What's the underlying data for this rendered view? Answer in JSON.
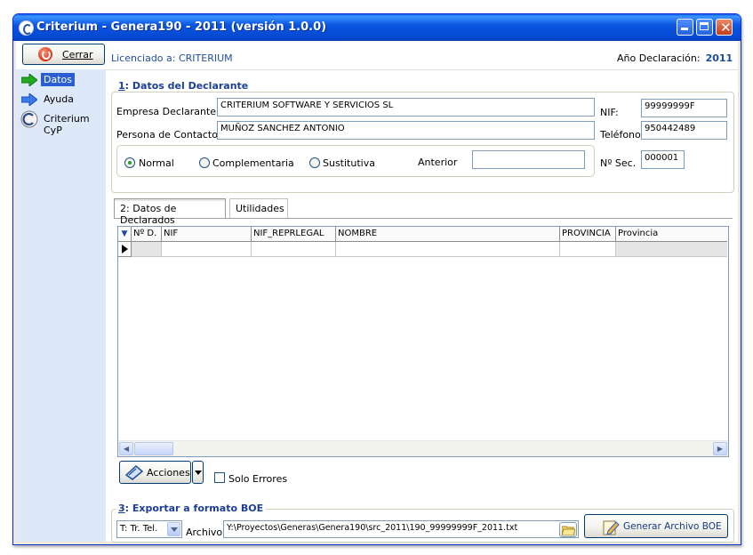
{
  "window": {
    "title": "Criterium - Genera190 - 2011 (versión 1.0.0)"
  },
  "toolbar": {
    "close_label": "Cerrar",
    "licensee": "Licenciado a: CRITERIUM",
    "year_label": "Año Declaración:",
    "year_value": "2011"
  },
  "sidebar": {
    "items": [
      {
        "label": "Datos",
        "icon": "green-arrow-icon",
        "selected": true
      },
      {
        "label": "Ayuda",
        "icon": "blue-arrow-icon",
        "selected": false
      },
      {
        "label": "Criterium CyP",
        "icon": "criterium-cyp-logo-icon",
        "selected": false
      }
    ]
  },
  "declarante": {
    "number": "1",
    "title": ": Datos del Declarante",
    "empresa_label": "Empresa Declarante:",
    "empresa_value": "CRITERIUM SOFTWARE Y SERVICIOS SL",
    "contacto_label": "Persona de Contacto",
    "contacto_value": "MUÑOZ SANCHEZ ANTONIO",
    "nif_label": "NIF:",
    "nif_value": "99999999F",
    "telefono_label": "Teléfono:",
    "telefono_value": "950442489",
    "tipo_options": [
      "Normal",
      "Complementaria",
      "Sustitutiva"
    ],
    "tipo_selected": "Normal",
    "anterior_label": "Anterior",
    "anterior_value": "",
    "nsec_label": "Nº Sec.",
    "nsec_value": "000001"
  },
  "tabs": [
    {
      "label": "2: Datos de Declarados",
      "active": true
    },
    {
      "label": "Utilidades",
      "active": false
    }
  ],
  "grid": {
    "columns": [
      "Nº D.",
      "NIF",
      "NIF_REPRLEGAL",
      "NOMBRE",
      "PROVINCIA",
      "Provincia"
    ],
    "rows": [
      [
        "",
        "",
        "",
        "",
        "",
        ""
      ]
    ]
  },
  "actions": {
    "acciones_label": "Acciones",
    "solo_errores_label": "Solo Errores",
    "solo_errores_checked": false
  },
  "export": {
    "number": "3",
    "title": ": Exportar a formato BOE",
    "type_value": "T: Tr. Tel.",
    "archivo_label": "Archivo",
    "archivo_value": "Y:\\Proyectos\\Generas\\Genera190\\src_2011\\190_99999999F_2011.txt",
    "generate_label": "Generar Archivo BOE"
  },
  "colors": {
    "titlebar": "#0348d1",
    "sidebar_bg": "#dde8f8",
    "group_title": "#1c3f95",
    "selected_item": "#2b5fd1"
  }
}
